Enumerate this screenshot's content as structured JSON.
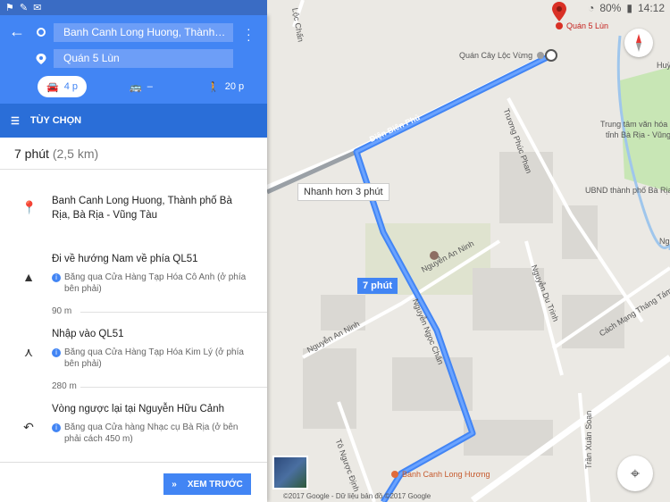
{
  "status_bar": {
    "battery": "80%",
    "time": "14:12"
  },
  "directions": {
    "origin": "Banh Canh Long Huong, Thành…",
    "destination": "Quán 5 Lùn",
    "modes": [
      {
        "name": "car",
        "label": "4 p"
      },
      {
        "name": "transit",
        "label": "–"
      },
      {
        "name": "walk",
        "label": "20 p"
      }
    ],
    "options_label": "TÙY CHỌN",
    "summary_time": "7 phút",
    "summary_distance": "(2,5 km)",
    "steps": [
      {
        "title": "Banh Canh Long Huong, Thành phố Bà Rịa, Bà Rịa - Vũng Tàu",
        "note": "",
        "distance": ""
      },
      {
        "title": "Đi về hướng Nam về phía QL51",
        "note": "Băng qua Cửa Hàng Tạp Hóa Cô Anh (ở phía bên phải)",
        "distance": "90 m"
      },
      {
        "title": "Nhập vào QL51",
        "note": "Băng qua Cửa Hàng Tạp Hóa Kim Lý (ở phía bên phải)",
        "distance": "280 m"
      },
      {
        "title": "Vòng ngược lại tại Nguyễn Hữu Cảnh",
        "note": "Băng qua Cửa hàng Nhạc cụ Bà Rịa (ở bên phải cách 450 m)",
        "distance": ""
      }
    ],
    "preview_label": "XEM TRƯỚC"
  },
  "map": {
    "destination_label": "Quán 5 Lùn",
    "callout": "Nhanh hơn 3 phút",
    "route_time": "7 phút",
    "copyright": "©2017 Google - Dữ liệu bản đồ ©2017 Google",
    "labels": [
      "Quán Cây Lộc Vừng",
      "Trương Phúc Phan",
      "Điện Biên Phủ",
      "Trung tâm văn hóa",
      "tỉnh Bà Rịa - Vũng Tàu",
      "UBND thành phố Bà Rịa",
      "Nguyễn An Ninh",
      "Nguyễn An Ninh",
      "Nguyễn Ngọc Chấn",
      "Nguyễn Du Trinh",
      "Cách Mạng Tháng Tám",
      "Tô Ngược Định",
      "Trần Xuân Soạn",
      "Banh Canh Long Hương",
      "Huỳ",
      "Nguyễn",
      "Lộc Chấn"
    ],
    "route_color": "#4285f4",
    "accent_color": "#4285f4"
  }
}
